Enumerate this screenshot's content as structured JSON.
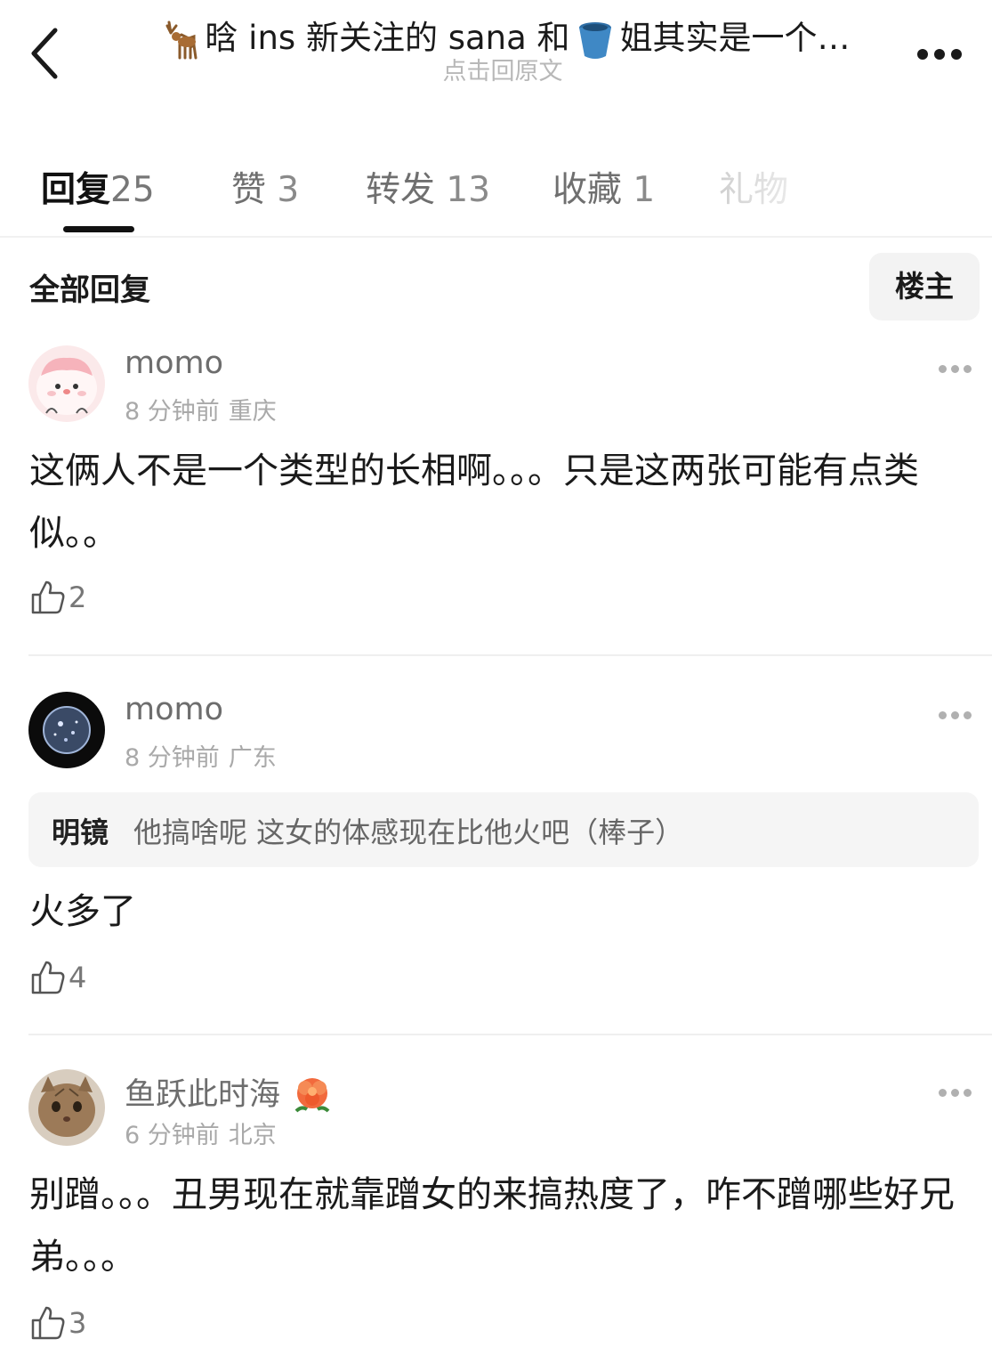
{
  "header": {
    "title_pre": "晗 ins 新关注的 sana 和",
    "title_post": "姐其实是一个…",
    "subtitle": "点击回原文"
  },
  "tabs": [
    {
      "label": "回复",
      "count": "25",
      "active": true
    },
    {
      "label": "赞",
      "count": "3"
    },
    {
      "label": "转发",
      "count": "13"
    },
    {
      "label": "收藏",
      "count": "1"
    },
    {
      "label": "礼物",
      "count": ""
    }
  ],
  "section": {
    "title": "全部回复",
    "filter_label": "楼主"
  },
  "comments": [
    {
      "username": "momo",
      "time": "8 分钟前",
      "location": "重庆",
      "text": "这俩人不是一个类型的长相啊。。。只是这两张可能有点类似。。",
      "likes": "2"
    },
    {
      "username": "momo",
      "time": "8 分钟前",
      "location": "广东",
      "quote_name": "明镜",
      "quote_text": "他搞啥呢 这女的体感现在比他火吧（棒子）",
      "text": "火多了",
      "likes": "4"
    },
    {
      "username": "鱼跃此时海",
      "time": "6 分钟前",
      "location": "北京",
      "text": "别蹭。。。丑男现在就靠蹭女的来搞热度了，咋不蹭哪些好兄弟。。。",
      "likes": "3"
    }
  ],
  "icons": [
    "back-arrow-icon",
    "deer-emoji-icon",
    "bucket-emoji-icon",
    "more-icon",
    "thumbs-up-icon",
    "flower-badge-icon"
  ]
}
